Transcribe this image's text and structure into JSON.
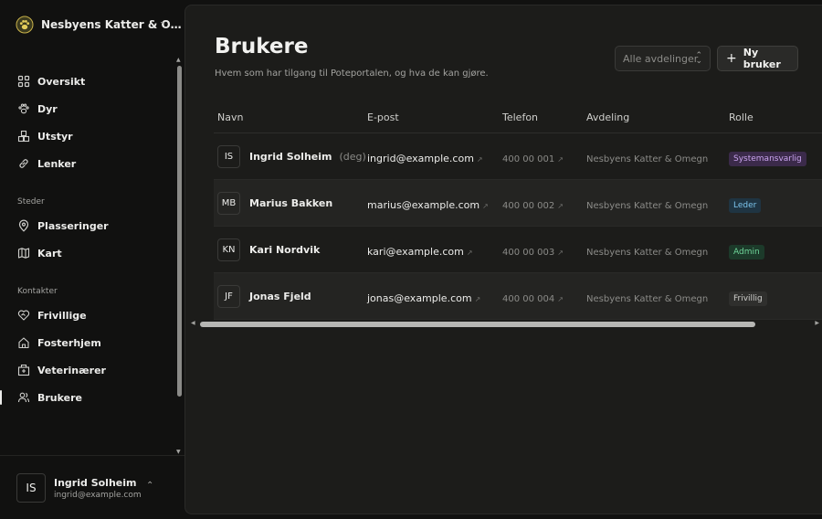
{
  "org": {
    "name": "Nesbyens Katter & O…"
  },
  "nav": {
    "main": [
      {
        "label": "Oversikt",
        "icon": "grid-icon"
      },
      {
        "label": "Dyr",
        "icon": "paw-icon"
      },
      {
        "label": "Utstyr",
        "icon": "boxes-icon"
      },
      {
        "label": "Lenker",
        "icon": "link-icon"
      }
    ],
    "places_header": "Steder",
    "places": [
      {
        "label": "Plasseringer",
        "icon": "map-pin-icon"
      },
      {
        "label": "Kart",
        "icon": "map-icon"
      }
    ],
    "contacts_header": "Kontakter",
    "contacts": [
      {
        "label": "Frivillige",
        "icon": "heart-handshake-icon"
      },
      {
        "label": "Fosterhjem",
        "icon": "home-icon"
      },
      {
        "label": "Veterinærer",
        "icon": "hospital-icon"
      },
      {
        "label": "Brukere",
        "icon": "users-icon",
        "active": true
      }
    ]
  },
  "current_user": {
    "initials": "IS",
    "name": "Ingrid Solheim",
    "email": "ingrid@example.com"
  },
  "page": {
    "title": "Brukere",
    "subtitle": "Hvem som har tilgang til Poteportalen, og hva de kan gjøre.",
    "filter_label": "Alle avdelinger",
    "new_button": "Ny bruker"
  },
  "table": {
    "columns": [
      "Navn",
      "E-post",
      "Telefon",
      "Avdeling",
      "Rolle"
    ],
    "rows": [
      {
        "initials": "IS",
        "name": "Ingrid Solheim",
        "you": "(deg)",
        "email": "ingrid@example.com",
        "phone": "400 00 001",
        "dept": "Nesbyens Katter & Omegn",
        "role": "Systemansvarlig"
      },
      {
        "initials": "MB",
        "name": "Marius Bakken",
        "you": "",
        "email": "marius@example.com",
        "phone": "400 00 002",
        "dept": "Nesbyens Katter & Omegn",
        "role": "Leder"
      },
      {
        "initials": "KN",
        "name": "Kari Nordvik",
        "you": "",
        "email": "kari@example.com",
        "phone": "400 00 003",
        "dept": "Nesbyens Katter & Omegn",
        "role": "Admin"
      },
      {
        "initials": "JF",
        "name": "Jonas Fjeld",
        "you": "",
        "email": "jonas@example.com",
        "phone": "400 00 004",
        "dept": "Nesbyens Katter & Omegn",
        "role": "Frivillig"
      }
    ]
  },
  "role_colors": {
    "Systemansvarlig": {
      "bg": "#3b2a4a",
      "fg": "#c9a3ee"
    },
    "Leder": {
      "bg": "#1f3442",
      "fg": "#7cc4ec"
    },
    "Admin": {
      "bg": "#1c3a2a",
      "fg": "#6fd69a"
    },
    "Frivillig": {
      "bg": "#2f2f2d",
      "fg": "#cfcfcc"
    }
  }
}
